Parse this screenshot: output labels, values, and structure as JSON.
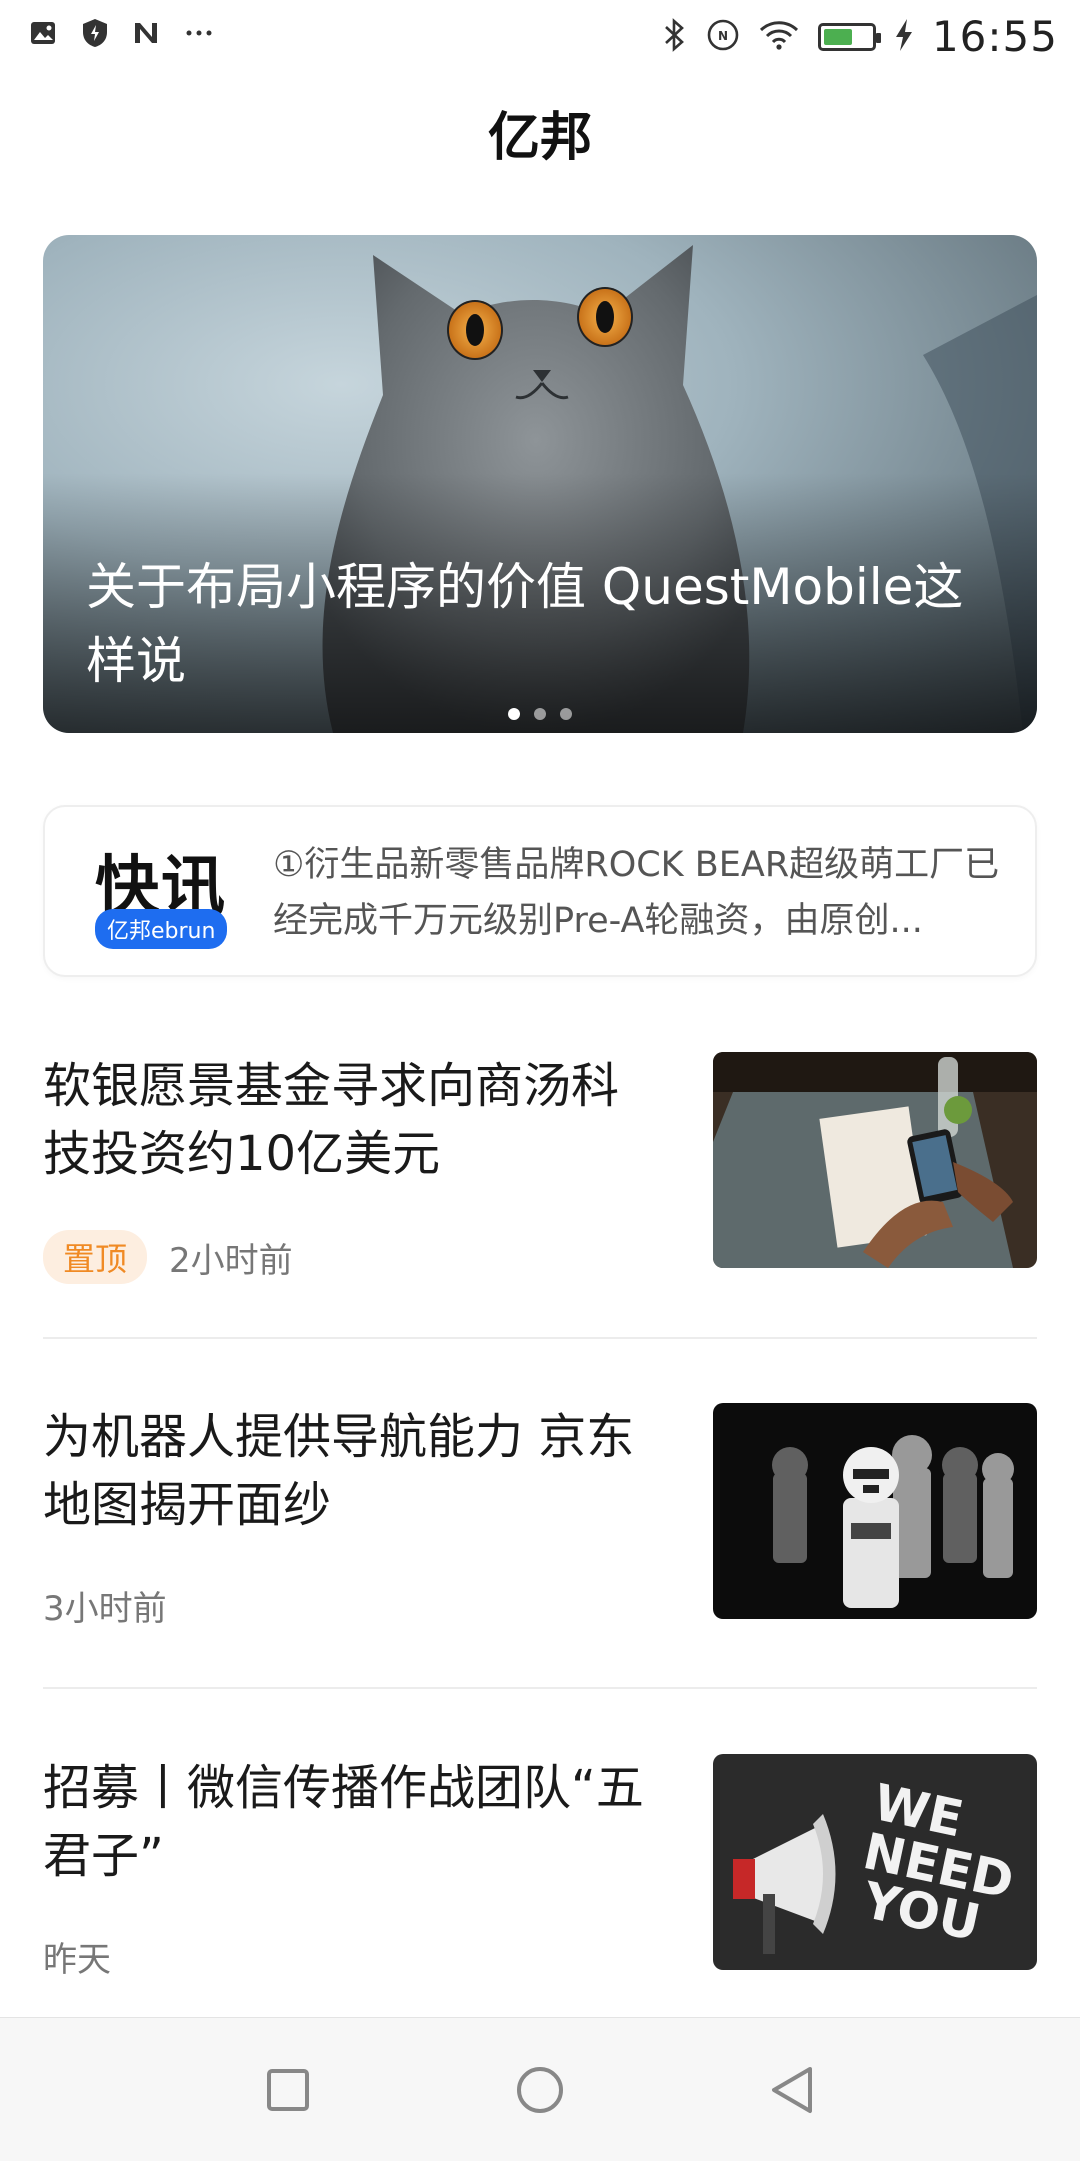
{
  "status_bar": {
    "time": "16:55",
    "left_icons": [
      "image-icon",
      "shield-icon",
      "n-icon",
      "more-dots-icon"
    ],
    "right_icons": [
      "bluetooth-icon",
      "nfc-icon",
      "wifi-icon",
      "battery-icon",
      "charging-icon"
    ],
    "battery_level": 0.6,
    "battery_color": "#4caf50"
  },
  "header": {
    "title": "亿邦"
  },
  "banner": {
    "title": "关于布局小程序的价值 QuestMobile这样说",
    "slide_count": 3,
    "active_slide": 1
  },
  "flash": {
    "label": "快讯",
    "badge": "亿邦ebrun",
    "text": "①衍生品新零售品牌ROCK BEAR超级萌工厂已经完成千万元级别Pre-A轮融资，由原创..."
  },
  "articles": [
    {
      "title": "软银愿景基金寻求向商汤科技投资约10亿美元",
      "tag": "置顶",
      "time": "2小时前"
    },
    {
      "title": "为机器人提供导航能力 京东地图揭开面纱",
      "tag": "",
      "time": "3小时前"
    },
    {
      "title": "招募丨微信传播作战团队“五君子”",
      "tag": "",
      "time": "昨天"
    }
  ],
  "colors": {
    "accent": "#1e6df0",
    "pin_text": "#f08a24",
    "pin_bg": "#fdeee0"
  },
  "nav": {
    "buttons": [
      "recent-apps-icon",
      "home-icon",
      "back-icon"
    ]
  }
}
